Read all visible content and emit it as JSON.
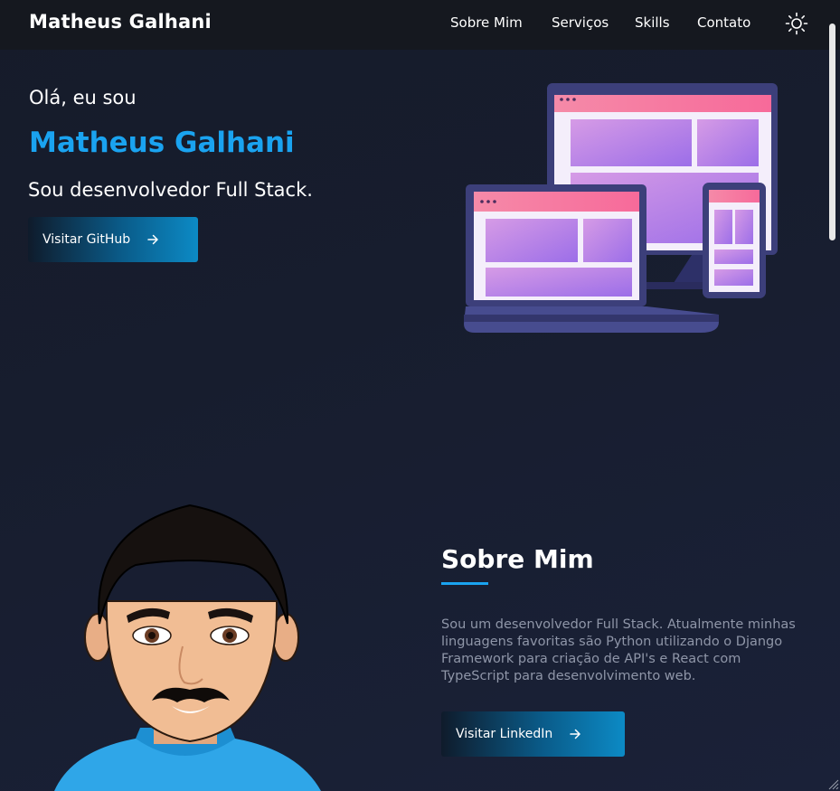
{
  "nav": {
    "brand": "Matheus Galhani",
    "links": [
      "Sobre Mim",
      "Serviços",
      "Skills",
      "Contato"
    ],
    "theme_icon": "sun-icon"
  },
  "hero": {
    "greeting": "Olá, eu sou",
    "name": "Matheus Galhani",
    "role": "Sou desenvolvedor Full Stack.",
    "button_label": "Visitar GitHub",
    "button_icon": "arrow-right-icon",
    "illustration": "devices-illustration"
  },
  "about": {
    "title": "Sobre Mim",
    "text": "Sou um desenvolvedor Full Stack. Atualmente minhas linguagens favoritas são Python utilizando o Django Framework para criação de API's e React com TypeScript para desenvolvimento web.",
    "button_label": "Visitar LinkedIn",
    "button_icon": "arrow-right-icon",
    "avatar": "avatar-illustration"
  },
  "colors": {
    "accent": "#1aa3f0",
    "background": "#171d2e",
    "navbar": "#15181f"
  }
}
